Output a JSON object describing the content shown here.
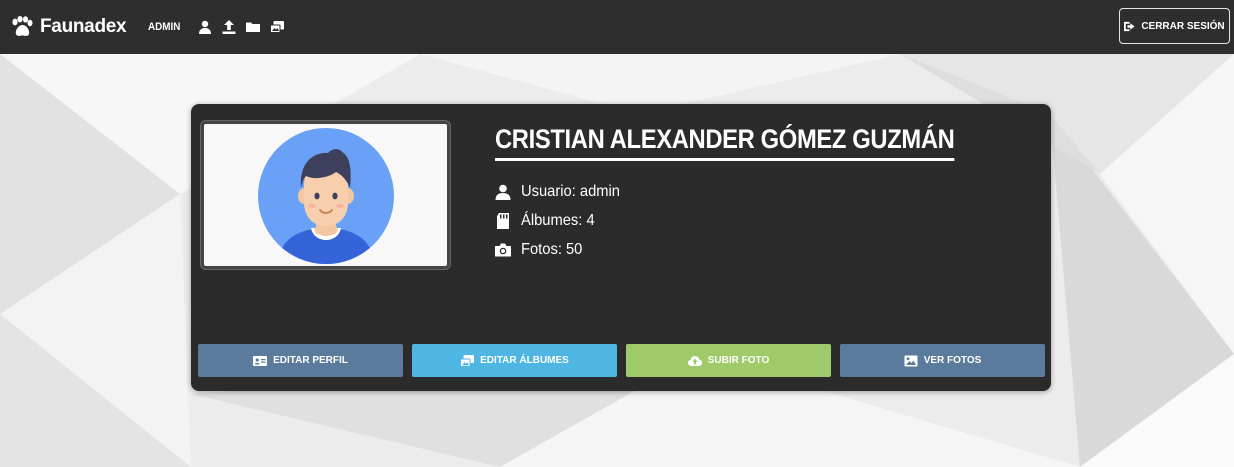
{
  "navbar": {
    "brand": "Faunadex",
    "admin_label": "ADMIN",
    "icons": [
      "user-icon",
      "upload-icon",
      "folder-icon",
      "albums-icon"
    ],
    "logout_label": "CERRAR SESIÓN",
    "background_color": "#2e2e2e"
  },
  "profile": {
    "full_name": "CRISTIAN ALEXANDER GÓMEZ GUZMÁN",
    "username_line": "Usuario: admin",
    "albums_line": "Álbumes: 4",
    "photos_line": "Fotos: 50"
  },
  "actions": {
    "edit_profile": "EDITAR PERFIL",
    "edit_albums": "EDITAR ÁLBUMES",
    "upload_photo": "SUBIR FOTO",
    "view_photos": "VER FOTOS"
  },
  "colors": {
    "card": "#2b2b2b",
    "edit_profile": "#5b7b9c",
    "edit_albums": "#4fb5e2",
    "upload_photo": "#9fca6a",
    "view_photos": "#5b7b9c",
    "avatar_circle": "#6aa1f7"
  }
}
